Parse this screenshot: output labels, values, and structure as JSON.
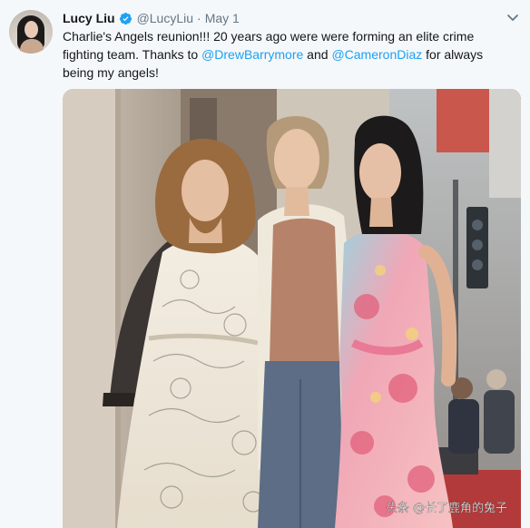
{
  "tweet": {
    "name": "Lucy Liu",
    "handle": "@LucyLiu",
    "separator": "·",
    "date": "May 1",
    "text_before_1": "Charlie's Angels reunion!!! 20 years ago were were forming an elite crime fighting team. Thanks to ",
    "mention_1": "@DrewBarrymore",
    "text_between": " and ",
    "mention_2": "@CameronDiaz",
    "text_after": " for always being my angels!"
  },
  "watermark": {
    "text": "头条 @长了鹿角的兔子"
  },
  "colors": {
    "link": "#1da1f2",
    "muted": "#657786",
    "verified": "#1da1f2"
  },
  "icons": {
    "verified": "verified-badge-icon",
    "menu": "chevron-down-icon"
  }
}
